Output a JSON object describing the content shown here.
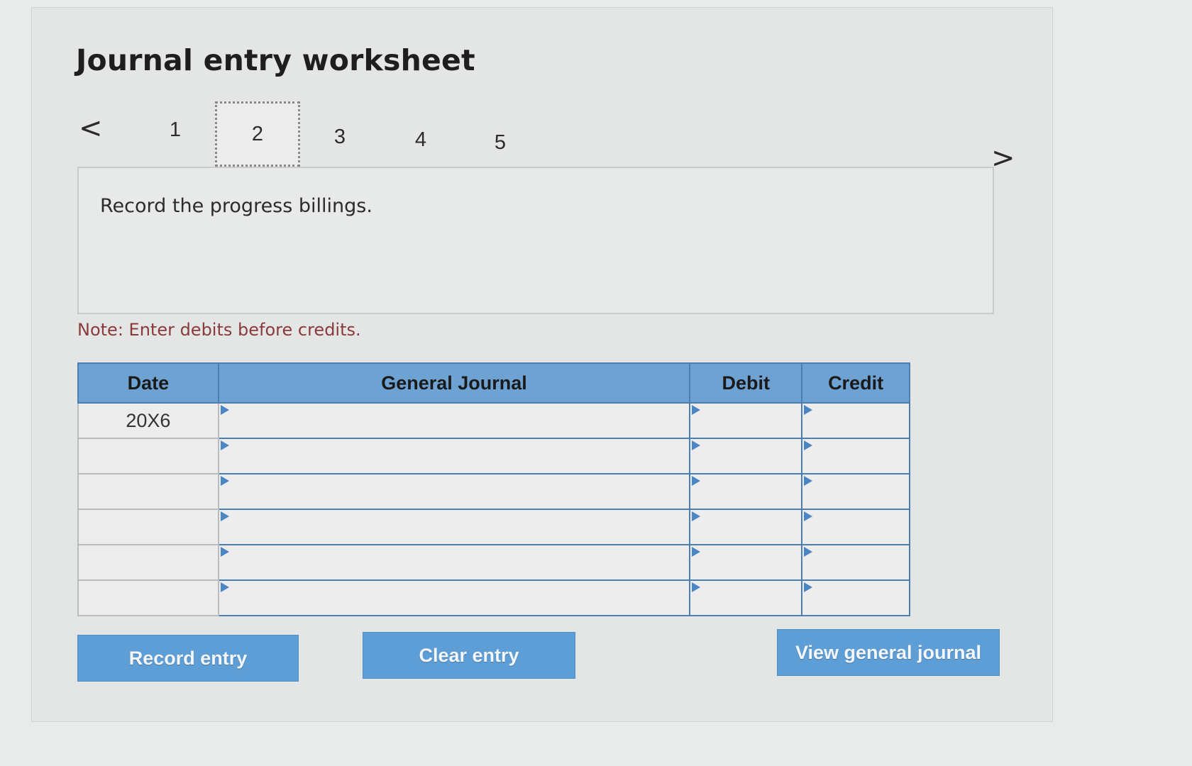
{
  "header": {
    "title": "Journal entry worksheet",
    "prev_icon": "chevron-left-icon",
    "next_icon": "chevron-right-icon",
    "prev_glyph": "<",
    "next_glyph": ">"
  },
  "steps": [
    {
      "label": "1",
      "active": false
    },
    {
      "label": "2",
      "active": true
    },
    {
      "label": "3",
      "active": false
    },
    {
      "label": "4",
      "active": false
    },
    {
      "label": "5",
      "active": false
    }
  ],
  "prompt": "Record the progress billings.",
  "note": "Note: Enter debits before credits.",
  "table": {
    "headers": [
      "Date",
      "General Journal",
      "Debit",
      "Credit"
    ],
    "rows": [
      {
        "date": "20X6",
        "account": "",
        "debit": "",
        "credit": ""
      },
      {
        "date": "",
        "account": "",
        "debit": "",
        "credit": ""
      },
      {
        "date": "",
        "account": "",
        "debit": "",
        "credit": ""
      },
      {
        "date": "",
        "account": "",
        "debit": "",
        "credit": ""
      },
      {
        "date": "",
        "account": "",
        "debit": "",
        "credit": ""
      },
      {
        "date": "",
        "account": "",
        "debit": "",
        "credit": ""
      }
    ]
  },
  "buttons": {
    "record": "Record entry",
    "clear": "Clear entry",
    "view": "View general journal"
  },
  "colors": {
    "header_blue": "#6da2d3",
    "button_blue": "#5e9ed6",
    "note_red": "#8a3a3a"
  }
}
